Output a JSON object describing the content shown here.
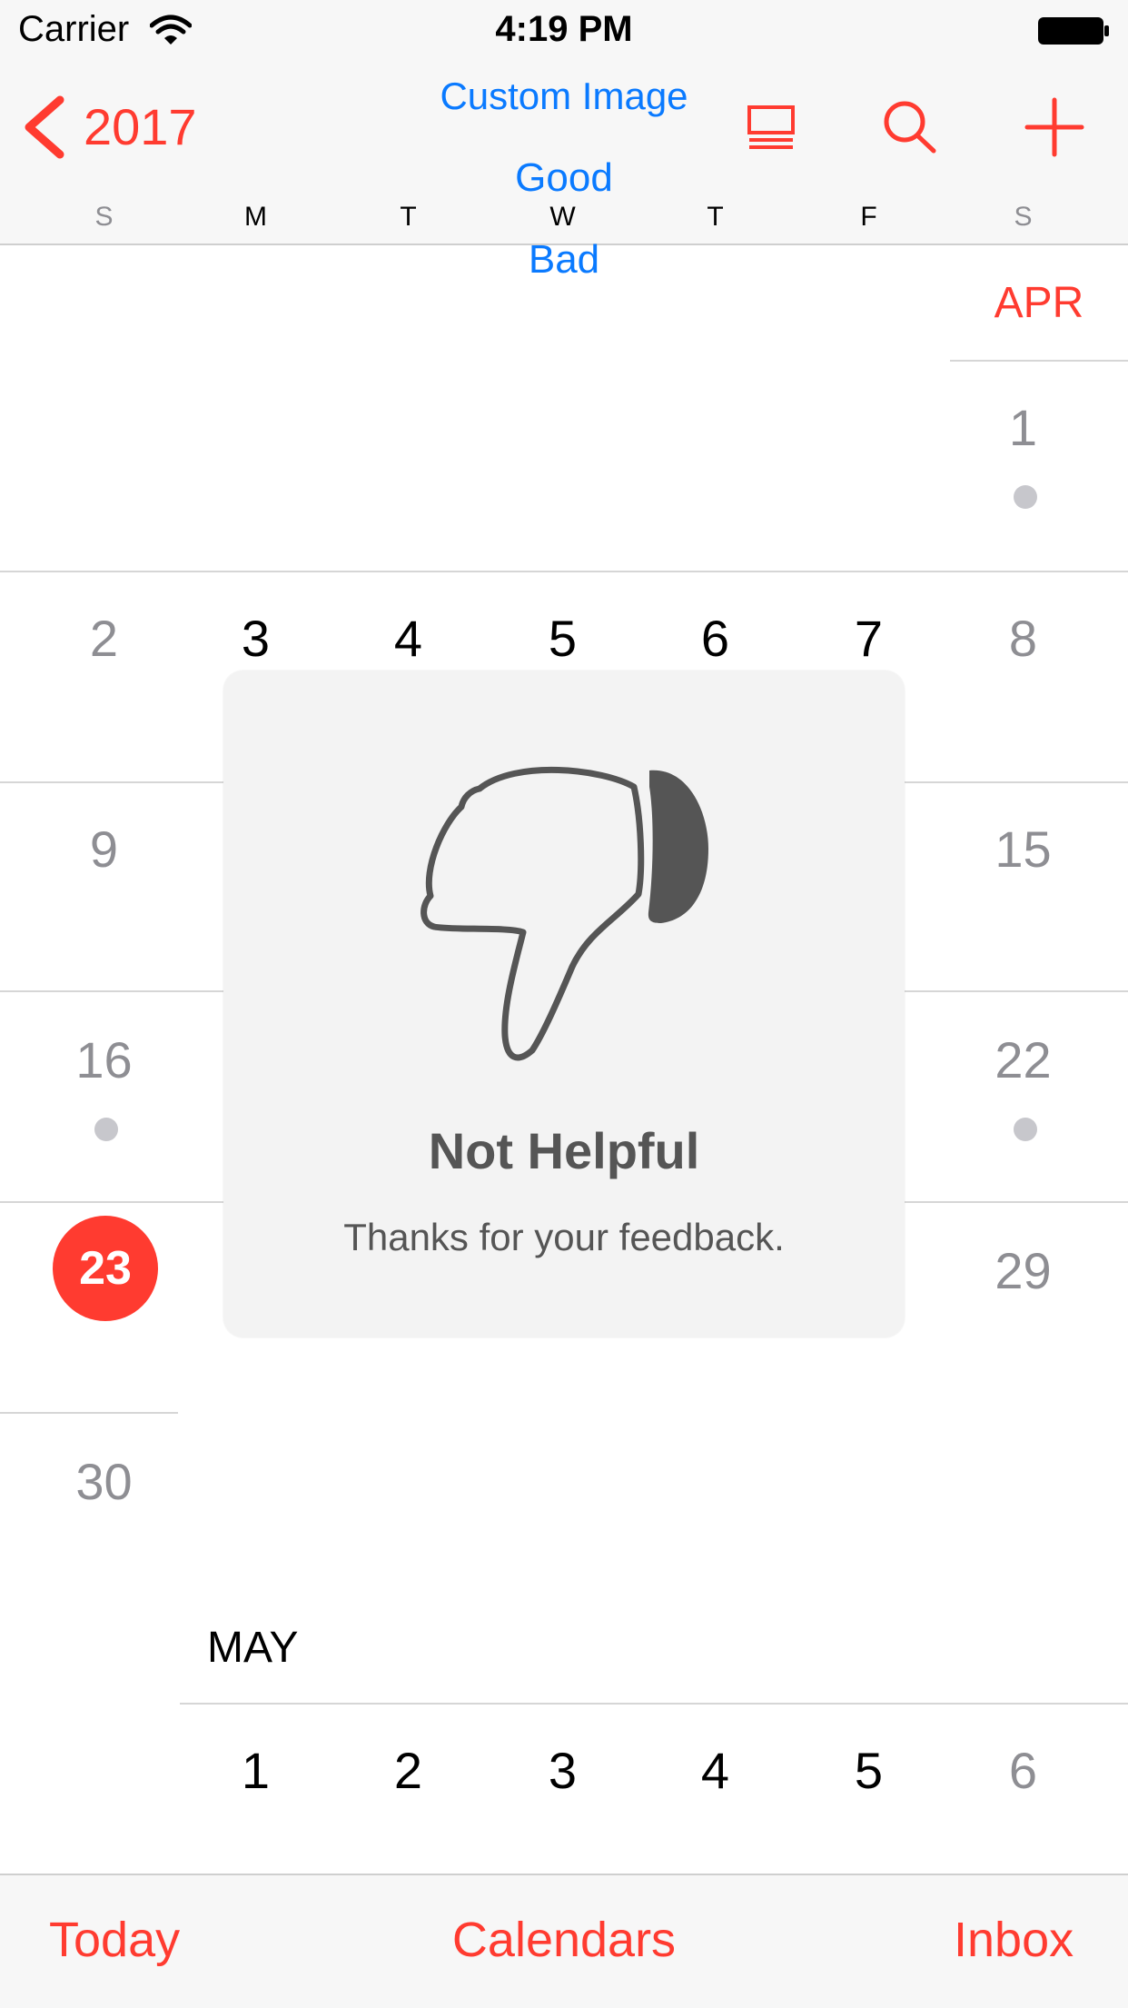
{
  "status_bar": {
    "carrier": "Carrier",
    "time": "4:19 PM"
  },
  "nav": {
    "year": "2017",
    "menu": {
      "custom_image": "Custom Image",
      "good": "Good",
      "bad": "Bad"
    }
  },
  "weekdays": [
    "S",
    "M",
    "T",
    "W",
    "T",
    "F",
    "S"
  ],
  "calendar": {
    "april_label": "APR",
    "april_rows": [
      [
        "",
        "",
        "",
        "",
        "",
        "",
        "1"
      ],
      [
        "2",
        "3",
        "4",
        "5",
        "6",
        "7",
        "8"
      ],
      [
        "9",
        "",
        "",
        "",
        "",
        "",
        "15"
      ],
      [
        "16",
        "",
        "",
        "",
        "",
        "",
        "22"
      ],
      [
        "23",
        "",
        "",
        "",
        "",
        "",
        "29"
      ],
      [
        "30",
        "",
        "",
        "",
        "",
        "",
        ""
      ]
    ],
    "may_label": "MAY",
    "may_row": [
      "",
      "1",
      "2",
      "3",
      "4",
      "5",
      "6"
    ],
    "today": "23"
  },
  "hud": {
    "title": "Not Helpful",
    "message": "Thanks for your feedback."
  },
  "tabbar": {
    "today": "Today",
    "calendars": "Calendars",
    "inbox": "Inbox"
  },
  "colors": {
    "accent": "#ff3b30",
    "link": "#0a7aff",
    "weekend": "#8e8e93",
    "dot": "#c7c7cc"
  },
  "icons": [
    "back-chevron-icon",
    "list-view-icon",
    "search-icon",
    "add-icon",
    "thumbs-down-icon",
    "wifi-icon",
    "battery-icon"
  ]
}
